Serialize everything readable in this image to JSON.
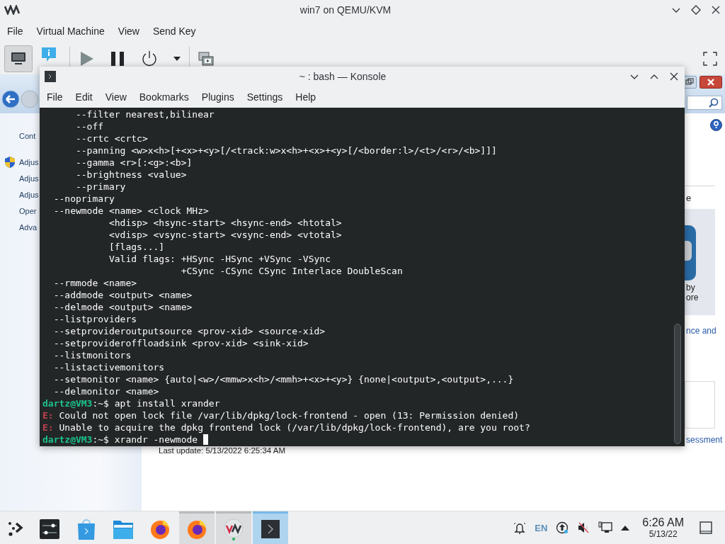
{
  "window": {
    "title": "win7 on QEMU/KVM"
  },
  "menu": [
    "File",
    "Virtual Machine",
    "View",
    "Send Key"
  ],
  "toolbar": {
    "view_buttons": [
      {
        "selected": true
      },
      {
        "selected": false
      }
    ]
  },
  "guest": {
    "nav_items": [
      {
        "label": "Cont",
        "kind": "plain"
      },
      {
        "label": "Adjus",
        "kind": "shield"
      },
      {
        "label": "Adjus",
        "kind": "plain"
      },
      {
        "label": "Adjus",
        "kind": "plain"
      },
      {
        "label": "Oper",
        "kind": "plain"
      },
      {
        "label": "Adva",
        "kind": "plain"
      }
    ],
    "last_update": "Last update: 5/13/2022 6:25:34 AM",
    "right_pane": {
      "heading": "e",
      "tile_caption": [
        "by",
        "ore"
      ],
      "links": [
        "nce and",
        "sessment"
      ]
    }
  },
  "konsole": {
    "title": "~ : bash — Konsole",
    "menu": [
      "File",
      "Edit",
      "View",
      "Bookmarks",
      "Plugins",
      "Settings",
      "Help"
    ],
    "lines": [
      {
        "kind": "output",
        "text": "      --filter nearest,bilinear"
      },
      {
        "kind": "output",
        "text": "      --off"
      },
      {
        "kind": "output",
        "text": "      --crtc <crtc>"
      },
      {
        "kind": "output",
        "text": "      --panning <w>x<h>[+<x>+<y>[/<track:w>x<h>+<x>+<y>[/<border:l>/<t>/<r>/<b>]]]"
      },
      {
        "kind": "output",
        "text": "      --gamma <r>[:<g>:<b>]"
      },
      {
        "kind": "output",
        "text": "      --brightness <value>"
      },
      {
        "kind": "output",
        "text": "      --primary"
      },
      {
        "kind": "output",
        "text": "  --noprimary"
      },
      {
        "kind": "output",
        "text": "  --newmode <name> <clock MHz>"
      },
      {
        "kind": "output",
        "text": "            <hdisp> <hsync-start> <hsync-end> <htotal>"
      },
      {
        "kind": "output",
        "text": "            <vdisp> <vsync-start> <vsync-end> <vtotal>"
      },
      {
        "kind": "output",
        "text": "            [flags...]"
      },
      {
        "kind": "output",
        "text": "            Valid flags: +HSync -HSync +VSync -VSync"
      },
      {
        "kind": "output",
        "text": "                         +CSync -CSync CSync Interlace DoubleScan"
      },
      {
        "kind": "output",
        "text": "  --rmmode <name>"
      },
      {
        "kind": "output",
        "text": "  --addmode <output> <name>"
      },
      {
        "kind": "output",
        "text": "  --delmode <output> <name>"
      },
      {
        "kind": "output",
        "text": "  --listproviders"
      },
      {
        "kind": "output",
        "text": "  --setprovideroutputsource <prov-xid> <source-xid>"
      },
      {
        "kind": "output",
        "text": "  --setprovideroffloadsink <prov-xid> <sink-xid>"
      },
      {
        "kind": "output",
        "text": "  --listmonitors"
      },
      {
        "kind": "output",
        "text": "  --listactivemonitors"
      },
      {
        "kind": "output",
        "text": "  --setmonitor <name> {auto|<w>/<mmw>x<h>/<mmh>+<x>+<y>} {none|<output>,<output>,...}"
      },
      {
        "kind": "output",
        "text": "  --delmonitor <name>"
      },
      {
        "kind": "prompt",
        "user": "dartz@VM3",
        "sep": ":~$",
        "command": "apt install xrander",
        "cursor": false
      },
      {
        "kind": "error",
        "tag": "E:",
        "text": "Could not open lock file /var/lib/dpkg/lock-frontend - open (13: Permission denied)"
      },
      {
        "kind": "error",
        "tag": "E:",
        "text": "Unable to acquire the dpkg frontend lock (/var/lib/dpkg/lock-frontend), are you root?"
      },
      {
        "kind": "prompt",
        "user": "dartz@VM3",
        "sep": ":~$",
        "command": "xrandr -newmode",
        "cursor": true
      }
    ]
  },
  "taskbar": {
    "tasks": [
      {
        "open": false,
        "selected": false
      },
      {
        "open": false,
        "selected": false
      },
      {
        "open": false,
        "selected": false
      },
      {
        "open": false,
        "selected": false
      },
      {
        "open": true,
        "selected": false
      },
      {
        "open": true,
        "selected": false
      },
      {
        "open": true,
        "selected": true
      }
    ],
    "tray": {
      "language": "EN",
      "time": "6:26 AM",
      "date": "5/13/22"
    }
  }
}
